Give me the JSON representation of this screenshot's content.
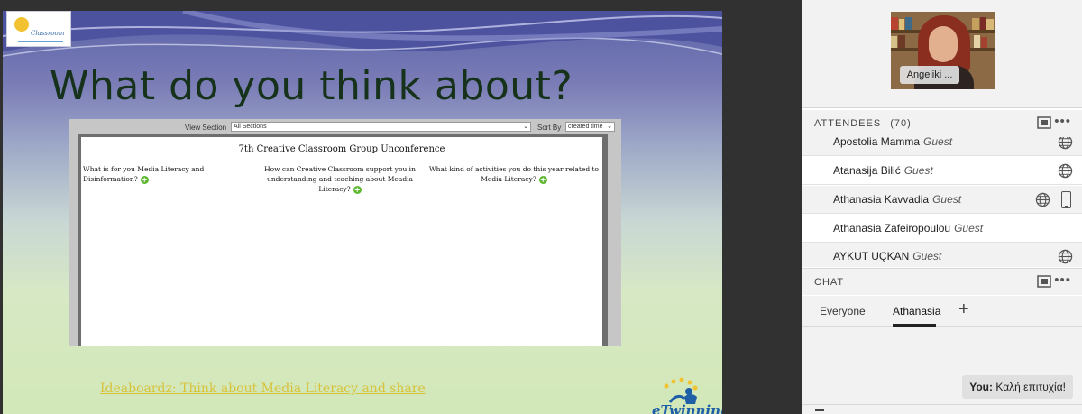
{
  "slide": {
    "title": "What do you think about?",
    "link_text": "Ideaboardz: Think about Media Literacy and share ",
    "etwinning_logo": "eTwinning",
    "board": {
      "view_section_label": "View Section",
      "view_section_value": "All Sections",
      "sort_by_label": "Sort By",
      "sort_by_value": "created time",
      "title": "7th Creative Classroom Group Unconference",
      "columns": [
        "What is for you Media Literacy and Disinformation?",
        "How can Creative Classroom support you in understanding and teaching about Meadia Literacy?",
        "What kind of activities you do this year related to Media Literacy?"
      ]
    }
  },
  "video": {
    "name_label": "Angeliki ..."
  },
  "attendees": {
    "title": "ATTENDEES",
    "count": "(70)",
    "rows": [
      {
        "name": "Apostolia Mamma",
        "role": "Guest"
      },
      {
        "name": "Atanasija Bilić",
        "role": "Guest"
      },
      {
        "name": "Athanasia Kavvadia",
        "role": "Guest"
      },
      {
        "name": "Athanasia Zafeiropoulou",
        "role": "Guest"
      },
      {
        "name": "AYKUT UÇKAN",
        "role": "Guest"
      }
    ]
  },
  "chat": {
    "title": "CHAT",
    "tabs": [
      "Everyone",
      "Athanasia"
    ],
    "add_tab": "+",
    "message": {
      "sender": "You:",
      "text": "Καλή επιτυχία!"
    }
  },
  "colors": {
    "title_green": "#16321a",
    "link_yellow": "#d8c23a",
    "plus_green": "#5cb830",
    "pod_bg": "#f2f2f2"
  }
}
